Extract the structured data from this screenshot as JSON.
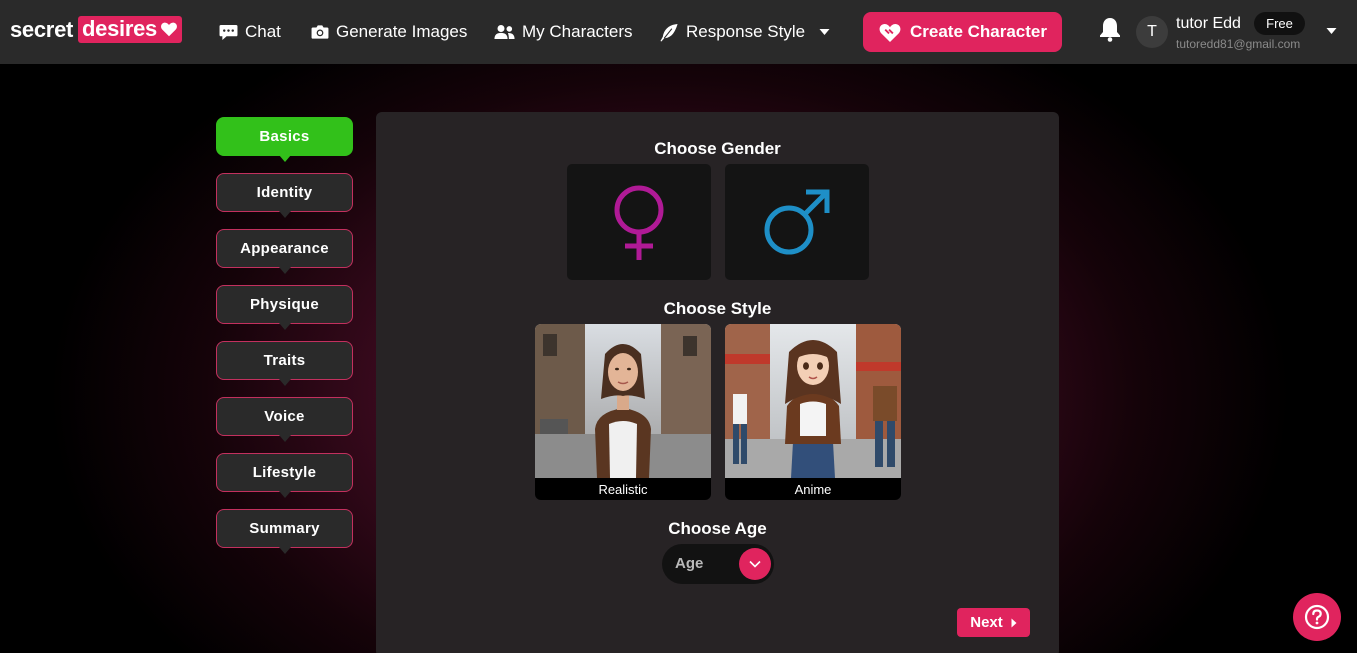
{
  "nav": {
    "logo_part1": "secret",
    "logo_part2": "desires",
    "items": [
      {
        "label": "Chat",
        "icon": "chat-bubble-icon"
      },
      {
        "label": "Generate Images",
        "icon": "camera-icon"
      },
      {
        "label": "My Characters",
        "icon": "users-icon"
      },
      {
        "label": "Response Style",
        "icon": "feather-icon"
      }
    ],
    "create_label": "Create Character",
    "user": {
      "initial": "T",
      "name": "tutor Edd",
      "email": "tutoredd81@gmail.com",
      "plan": "Free"
    }
  },
  "steps": [
    {
      "label": "Basics",
      "active": true
    },
    {
      "label": "Identity",
      "active": false
    },
    {
      "label": "Appearance",
      "active": false
    },
    {
      "label": "Physique",
      "active": false
    },
    {
      "label": "Traits",
      "active": false
    },
    {
      "label": "Voice",
      "active": false
    },
    {
      "label": "Lifestyle",
      "active": false
    },
    {
      "label": "Summary",
      "active": false
    }
  ],
  "main": {
    "gender_heading": "Choose Gender",
    "style_heading": "Choose Style",
    "styles": [
      {
        "label": "Realistic"
      },
      {
        "label": "Anime"
      }
    ],
    "age_heading": "Choose Age",
    "age_placeholder": "Age",
    "next_label": "Next"
  },
  "colors": {
    "accent": "#e0245e",
    "active_step": "#32c11a",
    "female_symbol": "#b01a96",
    "male_symbol": "#1e8fc7"
  }
}
